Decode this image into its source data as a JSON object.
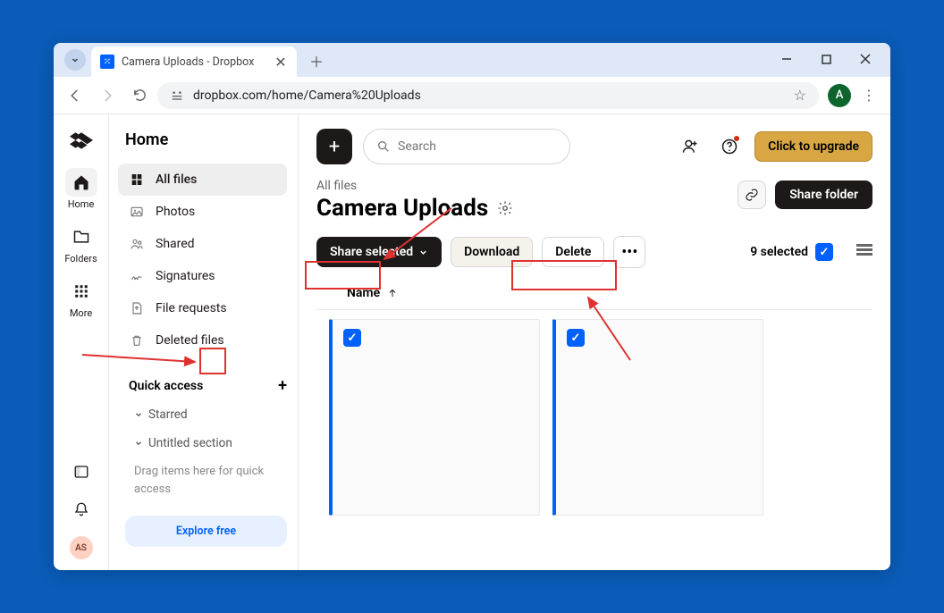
{
  "browser": {
    "tab_title": "Camera Uploads - Dropbox",
    "url": "dropbox.com/home/Camera%20Uploads",
    "profile_initial": "A"
  },
  "thin_sidebar": {
    "items": [
      {
        "label": "Home"
      },
      {
        "label": "Folders"
      },
      {
        "label": "More"
      }
    ],
    "avatar_initials": "AS"
  },
  "nav_panel": {
    "title": "Home",
    "links": [
      {
        "label": "All files"
      },
      {
        "label": "Photos"
      },
      {
        "label": "Shared"
      },
      {
        "label": "Signatures"
      },
      {
        "label": "File requests"
      },
      {
        "label": "Deleted files"
      }
    ],
    "quick_access_label": "Quick access",
    "starred_label": "Starred",
    "untitled_label": "Untitled section",
    "drag_hint": "Drag items here for quick access",
    "explore_label": "Explore free"
  },
  "topbar": {
    "search_placeholder": "Search",
    "upgrade_label": "Click to upgrade"
  },
  "page": {
    "breadcrumb": "All files",
    "title": "Camera Uploads",
    "share_folder_label": "Share folder"
  },
  "actions": {
    "share_selected_label": "Share selected",
    "download_label": "Download",
    "delete_label": "Delete",
    "selected_count_label": "9 selected"
  },
  "list": {
    "name_header": "Name"
  }
}
